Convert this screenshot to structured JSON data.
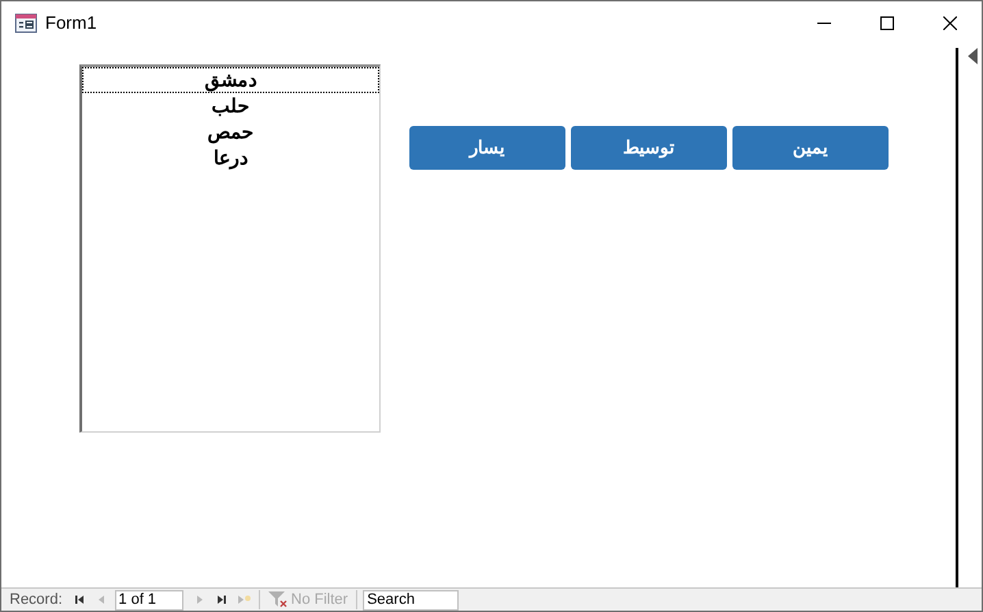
{
  "window": {
    "title": "Form1"
  },
  "listbox": {
    "items": [
      {
        "label": "دمشق",
        "selected": true
      },
      {
        "label": "حلب",
        "selected": false
      },
      {
        "label": "حمص",
        "selected": false
      },
      {
        "label": "درعا",
        "selected": false
      }
    ]
  },
  "buttons": [
    {
      "label": "يمين"
    },
    {
      "label": "توسيط"
    },
    {
      "label": "يسار"
    }
  ],
  "record_bar": {
    "label": "Record:",
    "position": "1 of 1",
    "nav": [
      {
        "kind": "first",
        "disabled": false
      },
      {
        "kind": "prev",
        "disabled": true
      }
    ],
    "nav_after": [
      {
        "kind": "next",
        "disabled": true
      },
      {
        "kind": "last",
        "disabled": false
      },
      {
        "kind": "new",
        "disabled": true
      }
    ],
    "filter": {
      "label": "No Filter",
      "disabled": true
    },
    "search": {
      "placeholder": "Search"
    }
  }
}
